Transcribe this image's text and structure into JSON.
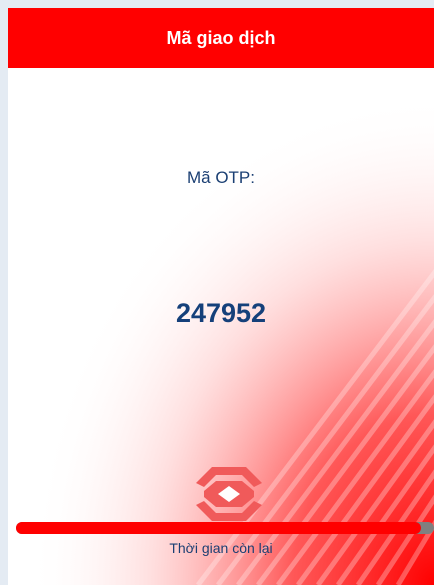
{
  "header": {
    "title": "Mã giao dịch"
  },
  "otp": {
    "label": "Mã OTP:",
    "code": "247952"
  },
  "timer": {
    "label": "Thời gian còn lại",
    "progress_fraction": 0.97
  },
  "logo": {
    "icon": "bank-logo-icon"
  },
  "colors": {
    "accent": "#ff0000",
    "text": "#1b3f73",
    "track": "#808080",
    "background": "#e4ebf3"
  }
}
